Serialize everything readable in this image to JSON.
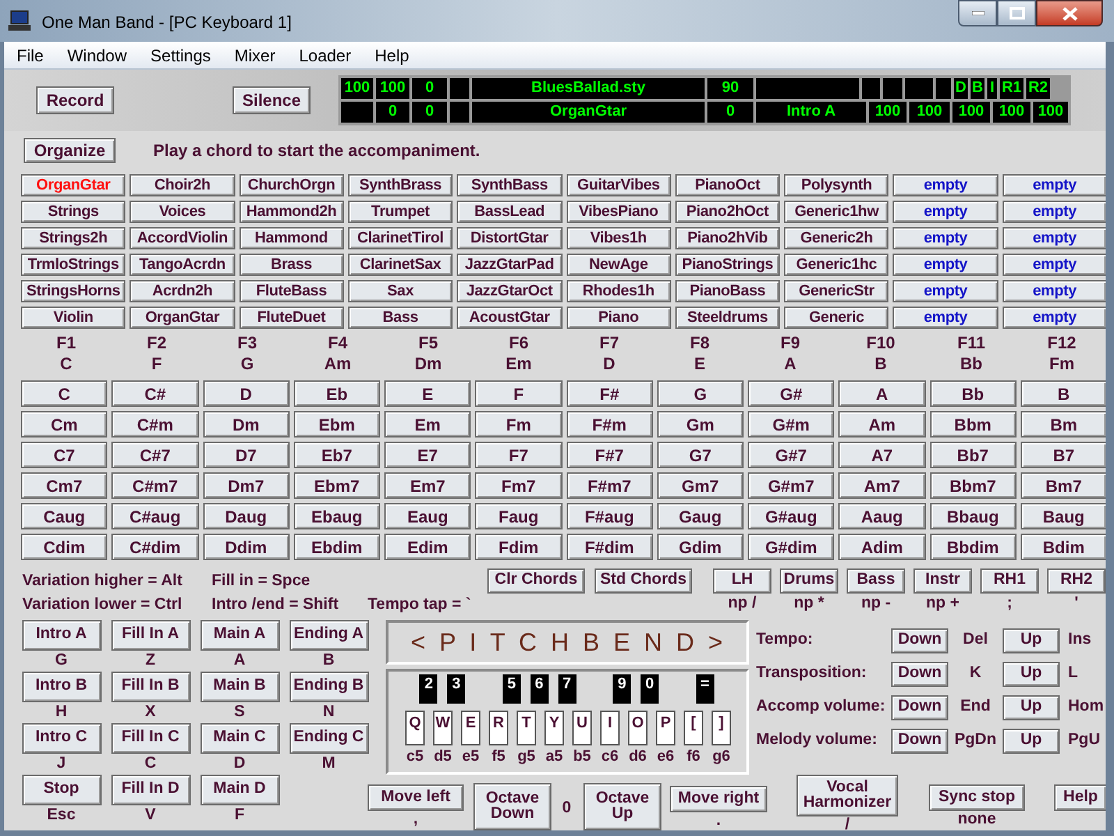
{
  "window": {
    "title": "One Man Band - [PC Keyboard 1]"
  },
  "menu": [
    "File",
    "Window",
    "Settings",
    "Mixer",
    "Loader",
    "Help"
  ],
  "transport": [
    "Record",
    "Silence"
  ],
  "display": {
    "row_1": [
      "100",
      "100",
      "0",
      "BluesBallad.sty",
      "90",
      "D",
      "B",
      "I",
      "R1",
      "R2"
    ],
    "row_2": [
      "0",
      "0",
      "OrganGtar",
      "0",
      "Intro A",
      "100",
      "100",
      "100",
      "100",
      "100"
    ]
  },
  "organize_button": "Organize",
  "message": "Play a chord to start the accompaniment.",
  "instruments": [
    {
      "label": "OrganGtar",
      "kind": "instrument",
      "selected": true
    },
    {
      "label": "Choir2h",
      "kind": "instrument",
      "selected": false
    },
    {
      "label": "ChurchOrgn",
      "kind": "instrument",
      "selected": false
    },
    {
      "label": "SynthBrass",
      "kind": "instrument",
      "selected": false
    },
    {
      "label": "SynthBass",
      "kind": "instrument",
      "selected": false
    },
    {
      "label": "GuitarVibes",
      "kind": "instrument",
      "selected": false
    },
    {
      "label": "PianoOct",
      "kind": "instrument",
      "selected": false
    },
    {
      "label": "Polysynth",
      "kind": "instrument",
      "selected": false
    },
    {
      "label": "empty",
      "kind": "empty",
      "selected": false
    },
    {
      "label": "empty",
      "kind": "empty",
      "selected": false
    },
    {
      "label": "Strings",
      "kind": "instrument",
      "selected": false
    },
    {
      "label": "Voices",
      "kind": "instrument",
      "selected": false
    },
    {
      "label": "Hammond2h",
      "kind": "instrument",
      "selected": false
    },
    {
      "label": "Trumpet",
      "kind": "instrument",
      "selected": false
    },
    {
      "label": "BassLead",
      "kind": "instrument",
      "selected": false
    },
    {
      "label": "VibesPiano",
      "kind": "instrument",
      "selected": false
    },
    {
      "label": "Piano2hOct",
      "kind": "instrument",
      "selected": false
    },
    {
      "label": "Generic1hw",
      "kind": "instrument",
      "selected": false
    },
    {
      "label": "empty",
      "kind": "empty",
      "selected": false
    },
    {
      "label": "empty",
      "kind": "empty",
      "selected": false
    },
    {
      "label": "Strings2h",
      "kind": "instrument",
      "selected": false
    },
    {
      "label": "AccordViolin",
      "kind": "instrument",
      "selected": false
    },
    {
      "label": "Hammond",
      "kind": "instrument",
      "selected": false
    },
    {
      "label": "ClarinetTirol",
      "kind": "instrument",
      "selected": false
    },
    {
      "label": "DistortGtar",
      "kind": "instrument",
      "selected": false
    },
    {
      "label": "Vibes1h",
      "kind": "instrument",
      "selected": false
    },
    {
      "label": "Piano2hVib",
      "kind": "instrument",
      "selected": false
    },
    {
      "label": "Generic2h",
      "kind": "instrument",
      "selected": false
    },
    {
      "label": "empty",
      "kind": "empty",
      "selected": false
    },
    {
      "label": "empty",
      "kind": "empty",
      "selected": false
    },
    {
      "label": "TrmloStrings",
      "kind": "instrument",
      "selected": false
    },
    {
      "label": "TangoAcrdn",
      "kind": "instrument",
      "selected": false
    },
    {
      "label": "Brass",
      "kind": "instrument",
      "selected": false
    },
    {
      "label": "ClarinetSax",
      "kind": "instrument",
      "selected": false
    },
    {
      "label": "JazzGtarPad",
      "kind": "instrument",
      "selected": false
    },
    {
      "label": "NewAge",
      "kind": "instrument",
      "selected": false
    },
    {
      "label": "PianoStrings",
      "kind": "instrument",
      "selected": false
    },
    {
      "label": "Generic1hc",
      "kind": "instrument",
      "selected": false
    },
    {
      "label": "empty",
      "kind": "empty",
      "selected": false
    },
    {
      "label": "empty",
      "kind": "empty",
      "selected": false
    },
    {
      "label": "StringsHorns",
      "kind": "instrument",
      "selected": false
    },
    {
      "label": "Acrdn2h",
      "kind": "instrument",
      "selected": false
    },
    {
      "label": "FluteBass",
      "kind": "instrument",
      "selected": false
    },
    {
      "label": "Sax",
      "kind": "instrument",
      "selected": false
    },
    {
      "label": "JazzGtarOct",
      "kind": "instrument",
      "selected": false
    },
    {
      "label": "Rhodes1h",
      "kind": "instrument",
      "selected": false
    },
    {
      "label": "PianoBass",
      "kind": "instrument",
      "selected": false
    },
    {
      "label": "GenericStr",
      "kind": "instrument",
      "selected": false
    },
    {
      "label": "empty",
      "kind": "empty",
      "selected": false
    },
    {
      "label": "empty",
      "kind": "empty",
      "selected": false
    },
    {
      "label": "Violin",
      "kind": "instrument",
      "selected": false
    },
    {
      "label": "OrganGtar",
      "kind": "instrument",
      "selected": false
    },
    {
      "label": "FluteDuet",
      "kind": "instrument",
      "selected": false
    },
    {
      "label": "Bass",
      "kind": "instrument",
      "selected": false
    },
    {
      "label": "AcoustGtar",
      "kind": "instrument",
      "selected": false
    },
    {
      "label": "Piano",
      "kind": "instrument",
      "selected": false
    },
    {
      "label": "Steeldrums",
      "kind": "instrument",
      "selected": false
    },
    {
      "label": "Generic",
      "kind": "instrument",
      "selected": false
    },
    {
      "label": "empty",
      "kind": "empty",
      "selected": false
    },
    {
      "label": "empty",
      "kind": "empty",
      "selected": false
    }
  ],
  "function_keys": [
    {
      "key": "F1",
      "chord": "C"
    },
    {
      "key": "F2",
      "chord": "F"
    },
    {
      "key": "F3",
      "chord": "G"
    },
    {
      "key": "F4",
      "chord": "Am"
    },
    {
      "key": "F5",
      "chord": "Dm"
    },
    {
      "key": "F6",
      "chord": "Em"
    },
    {
      "key": "F7",
      "chord": "D"
    },
    {
      "key": "F8",
      "chord": "E"
    },
    {
      "key": "F9",
      "chord": "A"
    },
    {
      "key": "F10",
      "chord": "B"
    },
    {
      "key": "F11",
      "chord": "Bb"
    },
    {
      "key": "F12",
      "chord": "Fm"
    }
  ],
  "chords": [
    [
      "C",
      "C#",
      "D",
      "Eb",
      "E",
      "F",
      "F#",
      "G",
      "G#",
      "A",
      "Bb",
      "B"
    ],
    [
      "Cm",
      "C#m",
      "Dm",
      "Ebm",
      "Em",
      "Fm",
      "F#m",
      "Gm",
      "G#m",
      "Am",
      "Bbm",
      "Bm"
    ],
    [
      "C7",
      "C#7",
      "D7",
      "Eb7",
      "E7",
      "F7",
      "F#7",
      "G7",
      "G#7",
      "A7",
      "Bb7",
      "B7"
    ],
    [
      "Cm7",
      "C#m7",
      "Dm7",
      "Ebm7",
      "Em7",
      "Fm7",
      "F#m7",
      "Gm7",
      "G#m7",
      "Am7",
      "Bbm7",
      "Bm7"
    ],
    [
      "Caug",
      "C#aug",
      "Daug",
      "Ebaug",
      "Eaug",
      "Faug",
      "F#aug",
      "Gaug",
      "G#aug",
      "Aaug",
      "Bbaug",
      "Baug"
    ],
    [
      "Cdim",
      "C#dim",
      "Ddim",
      "Ebdim",
      "Edim",
      "Fdim",
      "F#dim",
      "Gdim",
      "G#dim",
      "Adim",
      "Bbdim",
      "Bdim"
    ]
  ],
  "shortcuts": [
    [
      "Variation higher = Alt",
      "Fill in = Spce"
    ],
    [
      "Variation lower = Ctrl",
      "Intro /end = Shift",
      "Tempo tap = `"
    ]
  ],
  "chord_buttons": [
    "Clr Chords",
    "Std Chords"
  ],
  "parts": [
    {
      "label": "LH",
      "key": "np /"
    },
    {
      "label": "Drums",
      "key": "np *"
    },
    {
      "label": "Bass",
      "key": "np -"
    },
    {
      "label": "Instr",
      "key": "np +"
    },
    {
      "label": "RH1",
      "key": ";"
    },
    {
      "label": "RH2",
      "key": "'"
    }
  ],
  "sections": [
    {
      "label": "Intro A",
      "key": "G"
    },
    {
      "label": "Fill In A",
      "key": "Z"
    },
    {
      "label": "Main A",
      "key": "A"
    },
    {
      "label": "Ending A",
      "key": "B"
    },
    {
      "label": "Intro B",
      "key": "H"
    },
    {
      "label": "Fill In B",
      "key": "X"
    },
    {
      "label": "Main B",
      "key": "S"
    },
    {
      "label": "Ending B",
      "key": "N"
    },
    {
      "label": "Intro C",
      "key": "J"
    },
    {
      "label": "Fill In C",
      "key": "C"
    },
    {
      "label": "Main C",
      "key": "D"
    },
    {
      "label": "Ending C",
      "key": "M"
    },
    {
      "label": "Stop",
      "key": "Esc"
    },
    {
      "label": "Fill In D",
      "key": "V"
    },
    {
      "label": "Main D",
      "key": "F"
    }
  ],
  "pitchbend": "< P I T C H B E N D >",
  "keyboard": {
    "black_keys": [
      "2",
      "3",
      "5",
      "6",
      "7",
      "9",
      "0",
      "="
    ],
    "white_keys": [
      "Q",
      "W",
      "E",
      "R",
      "T",
      "Y",
      "U",
      "I",
      "O",
      "P",
      "[",
      "]"
    ],
    "notes": [
      "c5",
      "d5",
      "e5",
      "f5",
      "g5",
      "a5",
      "b5",
      "c6",
      "d6",
      "e6",
      "f6",
      "g6"
    ]
  },
  "controls": [
    {
      "label": "Tempo:",
      "down": "Down",
      "down_key": "Del",
      "up": "Up",
      "up_key": "Ins"
    },
    {
      "label": "Transposition:",
      "down": "Down",
      "down_key": "K",
      "up": "Up",
      "up_key": "L"
    },
    {
      "label": "Accomp volume:",
      "down": "Down",
      "down_key": "End",
      "up": "Up",
      "up_key": "Hom"
    },
    {
      "label": "Melody volume:",
      "down": "Down",
      "down_key": "PgDn",
      "up": "Up",
      "up_key": "PgU"
    }
  ],
  "bottom": [
    {
      "kind": "button",
      "label": "Move left",
      "key": ","
    },
    {
      "kind": "button",
      "label": "Octave Down"
    },
    {
      "kind": "reading",
      "label": "0"
    },
    {
      "kind": "button",
      "label": "Octave Up"
    },
    {
      "kind": "button",
      "label": "Move right",
      "key": "."
    },
    {
      "kind": "button",
      "label": "Vocal Harmonizer",
      "key": "/"
    },
    {
      "kind": "button",
      "label": "Sync stop",
      "key": "none"
    },
    {
      "kind": "button",
      "label": "Help"
    }
  ]
}
